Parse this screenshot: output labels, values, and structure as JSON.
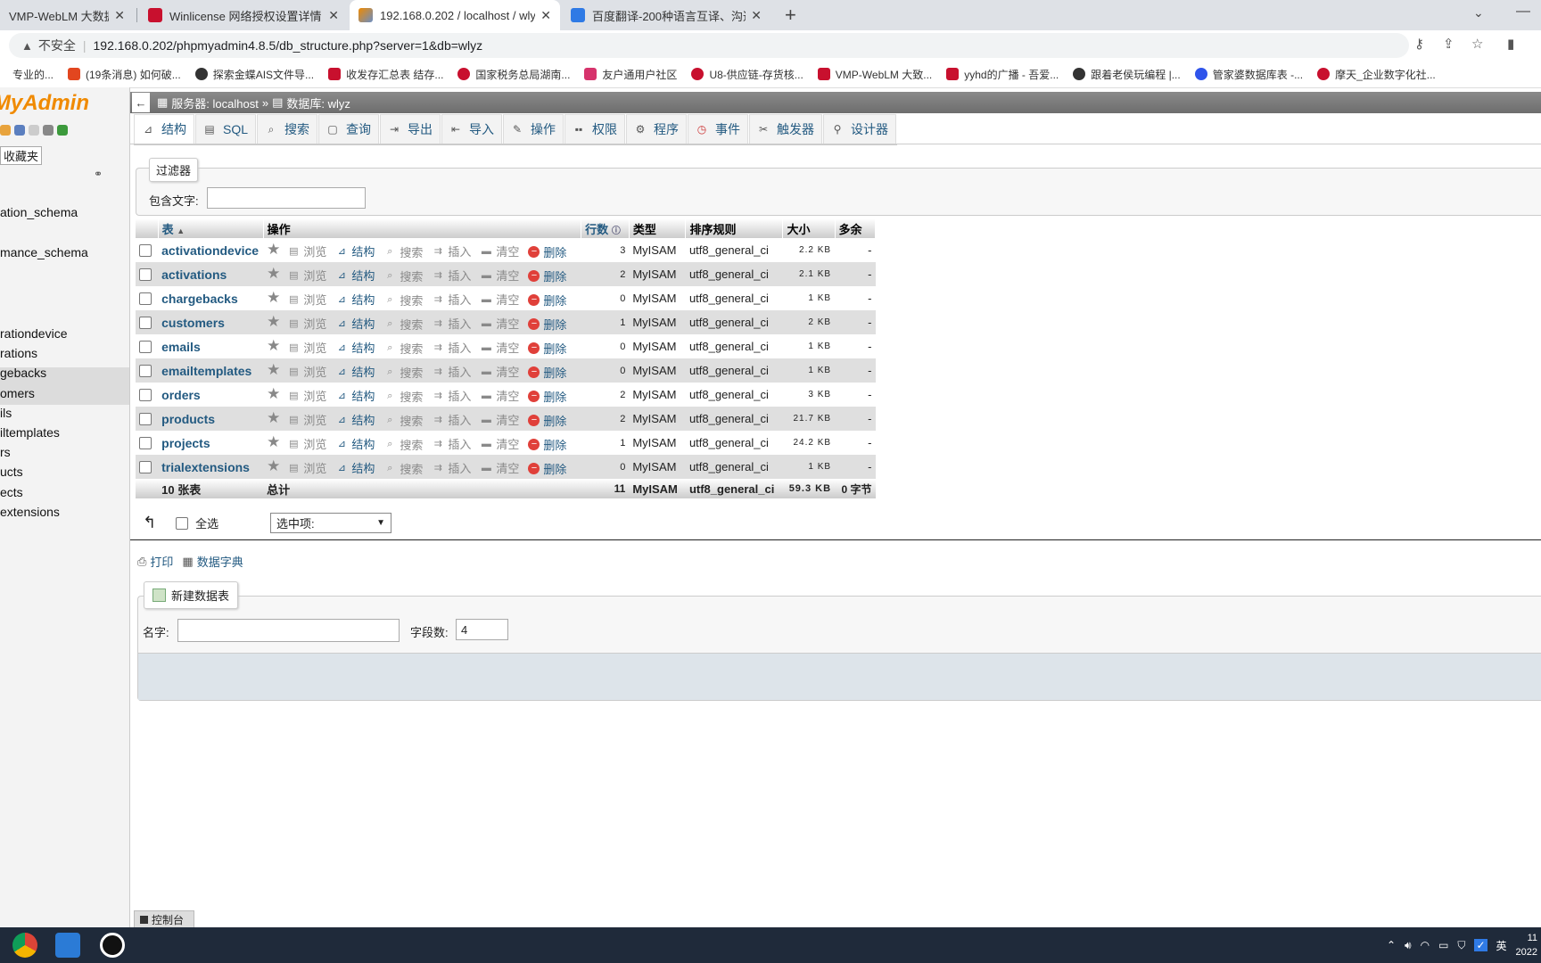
{
  "browser": {
    "tabs": [
      {
        "title": "VMP-WebLM 大数据",
        "active": false
      },
      {
        "title": "Winlicense 网络授权设置详情 -",
        "active": false
      },
      {
        "title": "192.168.0.202 / localhost / wly",
        "active": true
      },
      {
        "title": "百度翻译-200种语言互译、沟通",
        "active": false
      }
    ],
    "new_tab": "+",
    "close": "✕",
    "insecure_label": "不安全",
    "url": "192.168.0.202/phpmyadmin4.8.5/db_structure.php?server=1&db=wlyz",
    "bookmarks": [
      {
        "label": "专业的...",
        "color": "#ffffff"
      },
      {
        "label": "(19条消息) 如何破...",
        "color": "#e2461f"
      },
      {
        "label": "探索金蝶AIS文件导...",
        "color": "#333333"
      },
      {
        "label": "收发存汇总表 结存...",
        "color": "#c8102e"
      },
      {
        "label": "国家税务总局湖南...",
        "color": "#c8102e"
      },
      {
        "label": "友户通用户社区",
        "color": "#d6336c"
      },
      {
        "label": "U8-供应链-存货核...",
        "color": "#c8102e"
      },
      {
        "label": "VMP-WebLM 大致...",
        "color": "#c8102e"
      },
      {
        "label": "yyhd的广播 - 吾爱...",
        "color": "#c8102e"
      },
      {
        "label": "跟着老侯玩编程 |...",
        "color": "#333333"
      },
      {
        "label": "管家婆数据库表 -...",
        "color": "#2f54eb"
      },
      {
        "label": "摩天_企业数字化社...",
        "color": "#c8102e"
      }
    ]
  },
  "nav": {
    "logo": "MyAdmin",
    "favorites": "收藏夹",
    "databases": [
      "ation_schema",
      "mance_schema"
    ],
    "tables": [
      "rationdevice",
      "rations",
      "gebacks",
      "omers",
      "ils",
      "iltemplates",
      "rs",
      "ucts",
      "ects",
      "extensions"
    ]
  },
  "breadcrumb": {
    "back": "←",
    "server": "服务器: localhost",
    "sep": "»",
    "db": "数据库: wlyz"
  },
  "tabs": [
    {
      "label": "结构",
      "icon": "structure-icon",
      "active": true
    },
    {
      "label": "SQL",
      "icon": "sql-icon"
    },
    {
      "label": "搜索",
      "icon": "search-icon"
    },
    {
      "label": "查询",
      "icon": "query-icon"
    },
    {
      "label": "导出",
      "icon": "export-icon"
    },
    {
      "label": "导入",
      "icon": "import-icon"
    },
    {
      "label": "操作",
      "icon": "operations-icon"
    },
    {
      "label": "权限",
      "icon": "privileges-icon"
    },
    {
      "label": "程序",
      "icon": "routines-icon"
    },
    {
      "label": "事件",
      "icon": "events-icon"
    },
    {
      "label": "触发器",
      "icon": "triggers-icon"
    },
    {
      "label": "设计器",
      "icon": "designer-icon"
    }
  ],
  "filter": {
    "legend": "过滤器",
    "label": "包含文字:"
  },
  "table": {
    "headers": {
      "table": "表",
      "sort": "▲",
      "action": "操作",
      "rows": "行数",
      "type": "类型",
      "collation": "排序规则",
      "size": "大小",
      "overhead": "多余"
    },
    "actions": {
      "browse": "浏览",
      "structure": "结构",
      "search": "搜索",
      "insert": "插入",
      "empty": "清空",
      "drop": "删除"
    },
    "rows": [
      {
        "name": "activationdevice",
        "rows": "3",
        "type": "MyISAM",
        "collation": "utf8_general_ci",
        "size": "2.2 KB",
        "overhead": "-"
      },
      {
        "name": "activations",
        "rows": "2",
        "type": "MyISAM",
        "collation": "utf8_general_ci",
        "size": "2.1 KB",
        "overhead": "-"
      },
      {
        "name": "chargebacks",
        "rows": "0",
        "type": "MyISAM",
        "collation": "utf8_general_ci",
        "size": "1 KB",
        "overhead": "-"
      },
      {
        "name": "customers",
        "rows": "1",
        "type": "MyISAM",
        "collation": "utf8_general_ci",
        "size": "2 KB",
        "overhead": "-"
      },
      {
        "name": "emails",
        "rows": "0",
        "type": "MyISAM",
        "collation": "utf8_general_ci",
        "size": "1 KB",
        "overhead": "-"
      },
      {
        "name": "emailtemplates",
        "rows": "0",
        "type": "MyISAM",
        "collation": "utf8_general_ci",
        "size": "1 KB",
        "overhead": "-"
      },
      {
        "name": "orders",
        "rows": "2",
        "type": "MyISAM",
        "collation": "utf8_general_ci",
        "size": "3 KB",
        "overhead": "-"
      },
      {
        "name": "products",
        "rows": "2",
        "type": "MyISAM",
        "collation": "utf8_general_ci",
        "size": "21.7 KB",
        "overhead": "-"
      },
      {
        "name": "projects",
        "rows": "1",
        "type": "MyISAM",
        "collation": "utf8_general_ci",
        "size": "24.2 KB",
        "overhead": "-"
      },
      {
        "name": "trialextensions",
        "rows": "0",
        "type": "MyISAM",
        "collation": "utf8_general_ci",
        "size": "1 KB",
        "overhead": "-"
      }
    ],
    "footer": {
      "count": "10 张表",
      "total_label": "总计",
      "rows": "11",
      "type": "MyISAM",
      "collation": "utf8_general_ci",
      "size": "59.3 KB",
      "overhead": "0 字节"
    }
  },
  "with_selected": {
    "select_all": "全选",
    "dropdown": "选中项:"
  },
  "links": {
    "print": "打印",
    "dictionary": "数据字典"
  },
  "new_table": {
    "legend": "新建数据表",
    "name_label": "名字:",
    "fields_label": "字段数:",
    "fields_value": "4"
  },
  "console": "控制台",
  "taskbar": {
    "ime": "英",
    "time": "11",
    "date": "2022"
  }
}
